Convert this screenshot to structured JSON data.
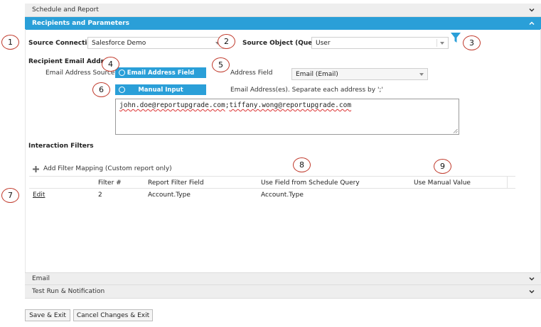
{
  "sections": {
    "schedule": "Schedule and Report",
    "recipients": "Recipients and Parameters",
    "email": "Email",
    "test_run": "Test Run & Notification"
  },
  "source": {
    "connection_label": "Source Connection",
    "connection_value": "Salesforce Demo",
    "object_label": "Source Object (Query)",
    "object_value": "User"
  },
  "recipient": {
    "heading": "Recipient Email Address",
    "source_label": "Email Address Source",
    "option_field": "Email Address Field",
    "option_manual": "Manual Input",
    "address_field_label": "Address Field",
    "address_field_value": "Email (Email)",
    "manual_hint": "Email Address(es). Separate each address by ';'",
    "emails": [
      "john.doe@reportupgrade.com",
      "tiffany.wong@reportupgrade.com"
    ],
    "separator": ";"
  },
  "filters": {
    "heading": "Interaction Filters",
    "add_label": "Add Filter Mapping (Custom report only)",
    "columns": [
      "Filter #",
      "Report Filter Field",
      "Use Field from Schedule Query",
      "Use Manual Value"
    ],
    "rows": [
      {
        "action": "Edit",
        "filter_no": "2",
        "report_field": "Account.Type",
        "schedule_field": "Account.Type",
        "manual_value": ""
      }
    ]
  },
  "buttons": {
    "save": "Save & Exit",
    "cancel": "Cancel Changes & Exit"
  },
  "callouts": [
    "1",
    "2",
    "3",
    "4",
    "5",
    "6",
    "7",
    "8",
    "9"
  ],
  "colors": {
    "accent": "#2a9fd8",
    "callout_border": "#c0392b",
    "filter_icon": "#2a9fd8"
  }
}
